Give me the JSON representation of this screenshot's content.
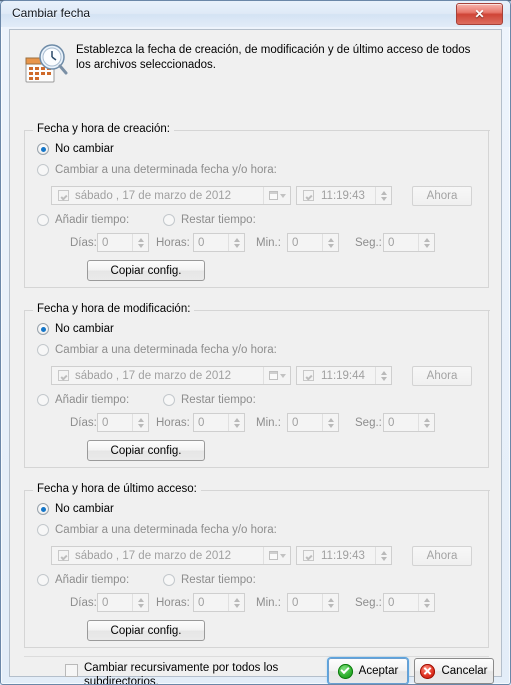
{
  "window": {
    "title": "Cambiar fecha",
    "close_label": "✕"
  },
  "header": {
    "icon": "calendar-clock-icon",
    "description": "Establezca la fecha de creación, de modificación y de último acceso de todos los archivos seleccionados."
  },
  "common": {
    "no_change": "No cambiar",
    "change_to": "Cambiar a una determinada fecha y/o hora:",
    "add_time": "Añadir tiempo:",
    "subtract_time": "Restar tiempo:",
    "now_button": "Ahora",
    "copy_button": "Copiar config.",
    "days_label": "Días:",
    "hours_label": "Horas:",
    "minutes_label": "Min.:",
    "seconds_label": "Seg.:",
    "zero": "0"
  },
  "groups": [
    {
      "legend": "Fecha y hora de creación:",
      "selected": "no_change",
      "date_value": "sábado , 17 de    marzo    de 2012",
      "time_value": "11:19:43"
    },
    {
      "legend": "Fecha y hora de modificación:",
      "selected": "no_change",
      "date_value": "sábado , 17 de    marzo    de 2012",
      "time_value": "11:19:44"
    },
    {
      "legend": "Fecha y hora de último acceso:",
      "selected": "no_change",
      "date_value": "sábado , 17 de    marzo    de 2012",
      "time_value": "11:19:43"
    }
  ],
  "footer": {
    "recursive_label": "Cambiar recursivamente por todos los subdirectorios.",
    "recursive_checked": false,
    "accept_label": "Aceptar",
    "cancel_label": "Cancelar"
  },
  "colors": {
    "accent_blue": "#1576c8",
    "ok_green": "#2fb02f",
    "cancel_red": "#e03020",
    "dialog_bg": "#f0f0f0"
  }
}
